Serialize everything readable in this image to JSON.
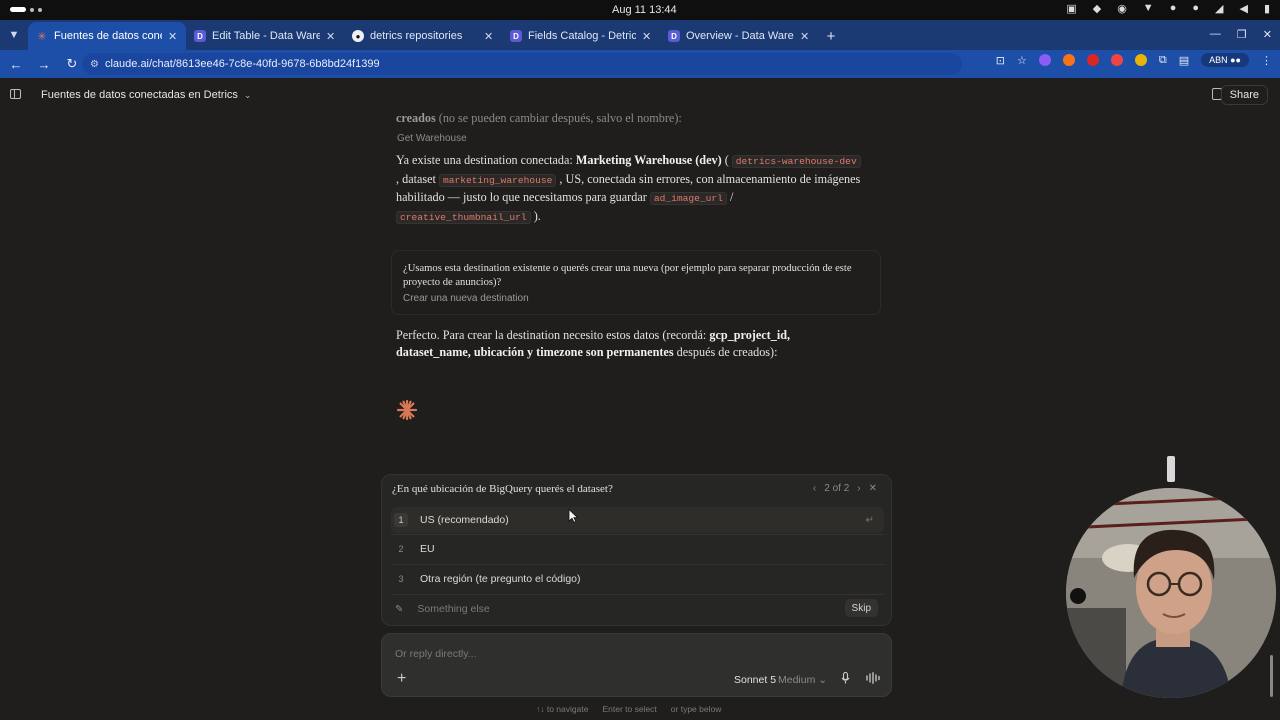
{
  "os": {
    "clock": "Aug 11  13:44"
  },
  "browser": {
    "tabs": [
      {
        "title": "Fuentes de datos conect",
        "favicon_color": "#d9643f",
        "active": true
      },
      {
        "title": "Edit Table - Data Wareho",
        "favicon_color": "#5b5bd6",
        "active": false
      },
      {
        "title": "detrics repositories",
        "favicon_color": "#f0f0f0",
        "active": false
      },
      {
        "title": "Fields Catalog - Detrics",
        "favicon_color": "#5b5bd6",
        "active": false
      },
      {
        "title": "Overview - Data Wareho",
        "favicon_color": "#5b5bd6",
        "active": false
      }
    ],
    "url": "claude.ai/chat/8613ee46-7c8e-40fd-9678-6b8bd24f1399",
    "profile_label": "ABN"
  },
  "header": {
    "title": "Fuentes de datos conectadas en Detrics",
    "share_label": "Share"
  },
  "conversation": {
    "faded_bold": "creados",
    "faded_rest": " (no se pueden cambiar después, salvo el nombre):",
    "tool_label": "Get Warehouse",
    "para1": {
      "t1": "Ya existe una destination conectada: ",
      "b1": "Marketing Warehouse (dev)",
      "t2": " ( ",
      "c1": "detrics-warehouse-dev",
      "t3": " , dataset ",
      "c2": "marketing_warehouse",
      "t4": " , US, conectada sin errores, con almacenamiento de imágenes habilitado — justo lo que necesitamos para guardar ",
      "c3": "ad_image_url",
      "t5": " / ",
      "c4": "creative_thumbnail_url",
      "t6": " )."
    },
    "qa": {
      "question": "¿Usamos esta destination existente o querés crear una nueva (por ejemplo para separar producción de este proyecto de anuncios)?",
      "answer": "Crear una nueva destination"
    },
    "para2": {
      "t1": "Perfecto. Para crear la destination necesito estos datos (recordá: ",
      "b1": "gcp_project_id, dataset_name, ubicación y timezone son permanentes",
      "t2": " después de creados):"
    }
  },
  "question_panel": {
    "title": "¿En qué ubicación de BigQuery querés el dataset?",
    "pager": "2 of 2",
    "options": [
      {
        "num": "1",
        "label": "US (recomendado)"
      },
      {
        "num": "2",
        "label": "EU"
      },
      {
        "num": "3",
        "label": "Otra región (te pregunto el código)"
      }
    ],
    "else_placeholder": "Something else",
    "skip_label": "Skip"
  },
  "composer": {
    "placeholder": "Or reply directly...",
    "model": "Sonnet 5",
    "effort": "Medium"
  },
  "hints": {
    "navigate": "↑↓ to navigate",
    "select": "Enter to select",
    "type": "or type below"
  },
  "colors": {
    "accent": "#d97757",
    "tab_bar": "#1b3a73",
    "active_tab": "#1e4fa8",
    "background": "#1f1e1d"
  }
}
